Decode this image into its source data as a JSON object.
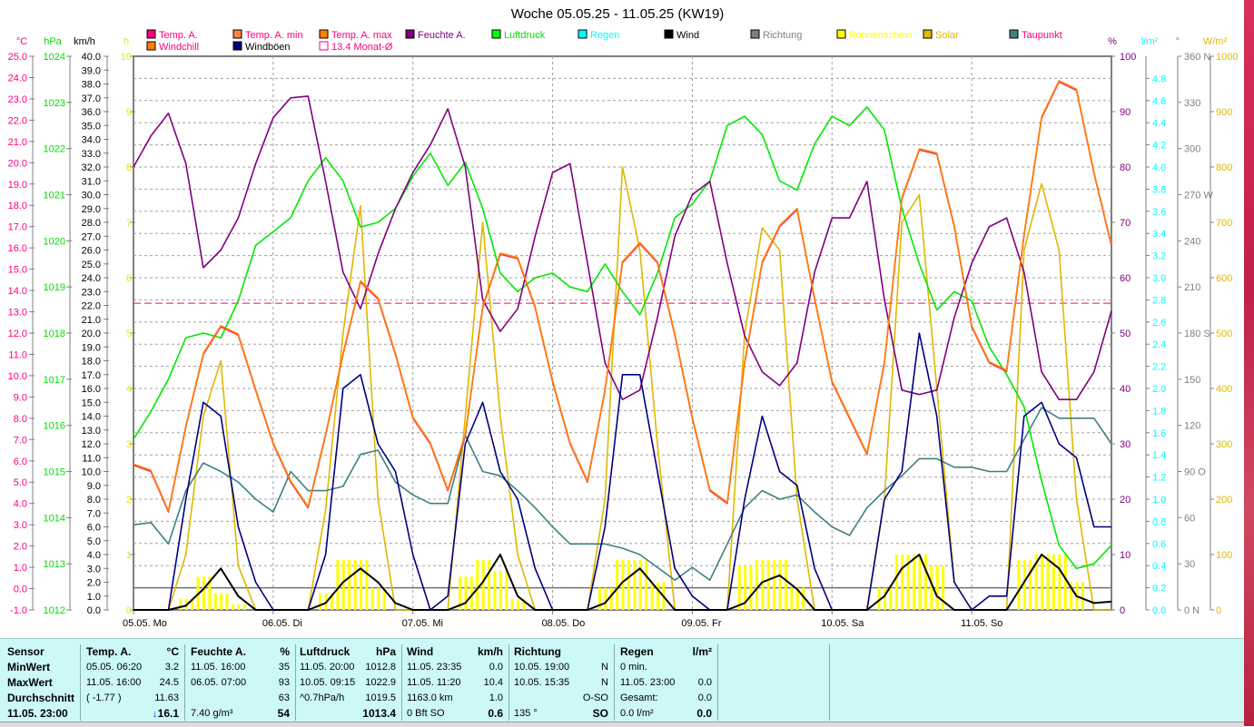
{
  "chart_data": {
    "type": "line",
    "title": "Woche 05.05.25 - 11.05.25 (KW19)",
    "x_unit": "hours since 05.05. 00:00",
    "x_step_hours": 3,
    "xlim": [
      0,
      168
    ],
    "day_labels": [
      "05.05.  Mo",
      "06.05.  Di",
      "07.05.  Mi",
      "08.05.  Do",
      "09.05.  Fr",
      "10.05.  Sa",
      "11.05.  So"
    ],
    "legend": [
      {
        "label": "Temp. A.",
        "color": "#ff0080",
        "row": 1
      },
      {
        "label": "Temp. A. min",
        "color": "#ff8040",
        "row": 1
      },
      {
        "label": "Temp. A. max",
        "color": "#ff8000",
        "row": 1
      },
      {
        "label": "Feuchte A.",
        "color": "#800080",
        "row": 1
      },
      {
        "label": "Luftdruck",
        "color": "#00ff00",
        "row": 1
      },
      {
        "label": "Regen",
        "color": "#00ffff",
        "row": 1
      },
      {
        "label": "Wind",
        "color": "#000000",
        "row": 1
      },
      {
        "label": "Richtung",
        "color": "#808080",
        "row": 1
      },
      {
        "label": "Sonnenschein",
        "color": "#ffff00",
        "row": 1
      },
      {
        "label": "Solar",
        "color": "#e0b800",
        "row": 1
      },
      {
        "label": "Taupunkt",
        "color": "#408080",
        "row": 1
      },
      {
        "label": "Windchill",
        "color": "#ff8000",
        "row": 2
      },
      {
        "label": "Windböen",
        "color": "#000080",
        "row": 2
      },
      {
        "label": "13.4 Monat-Ø",
        "color": "#ff0080",
        "row": 2,
        "outline": true
      }
    ],
    "legend_text_colors": {
      "Temp. A.": "#ff0080",
      "Temp. A. min": "#ff0080",
      "Temp. A. max": "#ff0080",
      "Feuchte A.": "#800080",
      "Luftdruck": "#00e000",
      "Regen": "#00ffff",
      "Wind": "#000000",
      "Richtung": "#808080",
      "Sonnenschein": "#ffff00",
      "Solar": "#e0b800",
      "Taupunkt": "#ff0080",
      "Windchill": "#ff0080",
      "Windböen": "#000000",
      "13.4 Monat-Ø": "#ff0080"
    },
    "axes": {
      "temp": {
        "unit": "°C",
        "min": -1,
        "max": 25,
        "step": 1,
        "decimals": 1,
        "color": "#ff0080"
      },
      "pressure": {
        "unit": "hPa",
        "min": 1012,
        "max": 1024,
        "step": 1,
        "decimals": 0,
        "color": "#00e000"
      },
      "wind": {
        "unit": "km/h",
        "min": 0,
        "max": 40,
        "step": 1,
        "decimals": 1,
        "color": "#000000"
      },
      "sun": {
        "unit": "h",
        "min": 0,
        "max": 10,
        "step": 1,
        "decimals": 0,
        "color": "#e8e800"
      },
      "humidity": {
        "unit": "%",
        "min": 0,
        "max": 100,
        "step": 10,
        "decimals": 0,
        "color": "#800080"
      },
      "rain": {
        "unit": "l/m²",
        "min": 0,
        "max": 5,
        "step": 0.2,
        "label_max": 4.8,
        "decimals": 1,
        "color": "#00ffff"
      },
      "direction": {
        "unit": "°",
        "min": 0,
        "max": 360,
        "step": 30,
        "decimals": 0,
        "color": "#808080",
        "suffix": {
          "360": " N",
          "270": " W",
          "180": " S",
          "90": " O",
          "0": " N"
        }
      },
      "solar": {
        "unit": "W/m²",
        "min": 0,
        "max": 1000,
        "step": 100,
        "decimals": 0,
        "color": "#e0b800"
      }
    },
    "monthly_avg_temp": 13.4,
    "reference_line_kmh": 1.6,
    "series": [
      {
        "name": "Temp. A.",
        "axis": "temp",
        "color": "#ff2060",
        "values": [
          5.8,
          5.5,
          3.6,
          7.6,
          11,
          12.3,
          11.9,
          9.3,
          6.8,
          5,
          3.8,
          7.2,
          11,
          14.4,
          13.6,
          11,
          8,
          6.8,
          4.6,
          7.2,
          13.2,
          15.7,
          15.5,
          13.2,
          9.7,
          6.8,
          5,
          9.3,
          15.3,
          16.2,
          15.3,
          11.9,
          8,
          4.6,
          4,
          10.6,
          15.3,
          17,
          17.8,
          13.6,
          9.7,
          8,
          6.3,
          10.6,
          18.3,
          20.6,
          20.4,
          17,
          12.3,
          10.6,
          10.2,
          16.6,
          22.1,
          23.8,
          23.4,
          19.5,
          16.1
        ]
      },
      {
        "name": "Windchill",
        "axis": "temp",
        "color": "#ff8000",
        "values": [
          5.8,
          5.5,
          3.6,
          7.6,
          11,
          12.3,
          11.9,
          9.3,
          6.8,
          5,
          3.8,
          7.2,
          11,
          14.4,
          13.6,
          11,
          8,
          6.8,
          4.6,
          7.2,
          13.2,
          15.7,
          15.5,
          13.2,
          9.7,
          6.8,
          5,
          9.3,
          15.3,
          16.2,
          15.3,
          11.9,
          8,
          4.6,
          4,
          10.6,
          15.3,
          17,
          17.8,
          13.6,
          9.7,
          8,
          6.3,
          10.6,
          18.3,
          20.6,
          20.4,
          17,
          12.3,
          10.6,
          10.2,
          16.6,
          22.1,
          23.8,
          23.4,
          19.5,
          16.1
        ]
      },
      {
        "name": "Feuchte A.",
        "axis": "humidity",
        "color": "#800080",
        "values": [
          80,
          85.6,
          89.7,
          80.6,
          61.8,
          65,
          70.8,
          80.6,
          88.9,
          92.5,
          92.8,
          77.4,
          61,
          54.4,
          64.3,
          72.5,
          79,
          84,
          90.5,
          80,
          56,
          50.3,
          54.4,
          67.5,
          79,
          80.6,
          62.6,
          44.6,
          38,
          39.7,
          52.8,
          67.5,
          75,
          77.4,
          62.6,
          49.5,
          43,
          40.5,
          44.6,
          61,
          70.8,
          70.8,
          77.4,
          56,
          39.7,
          38.9,
          39.7,
          52.8,
          62.6,
          69.2,
          70.8,
          61,
          43,
          38,
          38,
          43,
          54
        ]
      },
      {
        "name": "Luftdruck",
        "axis": "pressure",
        "color": "#00e800",
        "values": [
          1015.7,
          1016.3,
          1017,
          1017.9,
          1018,
          1017.9,
          1018.7,
          1019.9,
          1020.2,
          1020.5,
          1021.3,
          1021.8,
          1021.3,
          1020.3,
          1020.4,
          1020.7,
          1021.4,
          1021.9,
          1021.2,
          1021.7,
          1020.7,
          1019.3,
          1018.9,
          1019.2,
          1019.3,
          1019,
          1018.9,
          1019.5,
          1018.9,
          1018.4,
          1019.3,
          1020.5,
          1020.8,
          1021.3,
          1022.5,
          1022.7,
          1022.3,
          1021.3,
          1021.1,
          1022.1,
          1022.7,
          1022.5,
          1022.9,
          1022.4,
          1020.7,
          1019.5,
          1018.5,
          1018.9,
          1018.7,
          1017.7,
          1017.1,
          1016.4,
          1014.8,
          1013.4,
          1012.9,
          1013,
          1013.4
        ]
      },
      {
        "name": "Taupunkt",
        "axis": "temp",
        "color": "#408080",
        "values": [
          3,
          3.1,
          2.1,
          4.6,
          5.9,
          5.5,
          5,
          4.2,
          3.6,
          5.5,
          4.6,
          4.6,
          4.8,
          6.3,
          6.5,
          5,
          4.4,
          4,
          4,
          7.2,
          5.5,
          5.3,
          4.6,
          3.8,
          2.9,
          2.1,
          2.1,
          2.1,
          1.9,
          1.6,
          1,
          0.4,
          1,
          0.4,
          2.1,
          3.8,
          4.6,
          4.2,
          4.4,
          3.6,
          2.9,
          2.5,
          3.8,
          4.6,
          5.3,
          6.1,
          6.1,
          5.7,
          5.7,
          5.5,
          5.5,
          7,
          8.5,
          8,
          8,
          8,
          6.8
        ]
      },
      {
        "name": "Windböen",
        "axis": "wind",
        "color": "#000080",
        "values": [
          0,
          0,
          0,
          8,
          15,
          14,
          6,
          2,
          0,
          0,
          0,
          4,
          16,
          17,
          12,
          10,
          4,
          0,
          1,
          12,
          15,
          10,
          8,
          3,
          0,
          0,
          0,
          6,
          17,
          17,
          10,
          3,
          1,
          0,
          0,
          8,
          14,
          10,
          9,
          3,
          0,
          0,
          0,
          8,
          10,
          20,
          14,
          2,
          0,
          1,
          1,
          14,
          15,
          12,
          11,
          6,
          6
        ]
      },
      {
        "name": "Wind",
        "axis": "wind",
        "color": "#000000",
        "values": [
          0,
          0,
          0,
          0.3,
          1.5,
          3,
          1,
          0,
          0,
          0,
          0,
          0.5,
          2,
          3,
          2,
          0.5,
          0,
          0,
          0,
          0.5,
          2,
          4,
          1,
          0,
          0,
          0,
          0,
          0.5,
          2,
          3,
          1.5,
          0,
          0,
          0,
          0,
          0.5,
          2,
          2.5,
          1.5,
          0,
          0,
          0,
          0,
          1,
          3,
          4,
          1,
          0,
          0,
          0,
          0,
          2,
          4,
          3,
          1,
          0.5,
          0.6
        ]
      },
      {
        "name": "Solar",
        "axis": "solar",
        "color": "#e0b800",
        "values": [
          0,
          0,
          0,
          100,
          350,
          450,
          80,
          0,
          0,
          0,
          0,
          180,
          500,
          730,
          200,
          0,
          0,
          0,
          0,
          350,
          700,
          350,
          100,
          0,
          0,
          0,
          0,
          200,
          800,
          650,
          300,
          0,
          0,
          0,
          0,
          500,
          690,
          650,
          200,
          0,
          0,
          0,
          0,
          200,
          700,
          750,
          400,
          50,
          0,
          0,
          0,
          650,
          770,
          650,
          200,
          0,
          0
        ]
      },
      {
        "name": "Sonnenschein",
        "axis": "sun",
        "color": "#ffff00",
        "bars": true,
        "values": [
          0,
          0,
          0,
          0.2,
          0.6,
          0.3,
          0.1,
          0,
          0,
          0,
          0,
          0.3,
          0.9,
          0.9,
          0.4,
          0,
          0,
          0,
          0,
          0.6,
          0.9,
          0.7,
          0.2,
          0,
          0,
          0,
          0,
          0.4,
          0.9,
          0.9,
          0.5,
          0,
          0,
          0,
          0,
          0.8,
          0.9,
          0.9,
          0.4,
          0,
          0,
          0,
          0,
          0.4,
          1,
          1,
          0.8,
          0,
          0,
          0,
          0,
          0.9,
          1,
          1,
          0.5,
          0,
          0
        ]
      }
    ]
  },
  "table": {
    "columns": [
      {
        "header": "Sensor",
        "unit": "",
        "rows": [
          [
            "MinWert",
            ""
          ],
          [
            "MaxWert",
            ""
          ],
          [
            "Durchschnitt",
            ""
          ],
          [
            "11.05. 23:00",
            ""
          ]
        ],
        "bold_labels": true
      },
      {
        "header": "Temp. A.",
        "unit": "°C",
        "rows": [
          [
            "05.05.  06:20",
            "3.2"
          ],
          [
            "11.05.  16:00",
            "24.5"
          ],
          [
            "( -1.77 )",
            "11.63"
          ],
          [
            "",
            "16.1"
          ]
        ],
        "trend_icon": "↓"
      },
      {
        "header": "Feuchte A.",
        "unit": "%",
        "rows": [
          [
            "11.05.  16:00",
            "35"
          ],
          [
            "06.05.  07:00",
            "93"
          ],
          [
            "",
            "63"
          ],
          [
            "7.40 g/m³",
            "54"
          ]
        ]
      },
      {
        "header": "Luftdruck",
        "unit": "hPa",
        "rows": [
          [
            "11.05.  20:00",
            "1012.8"
          ],
          [
            "10.05.  09:15",
            "1022.9"
          ],
          [
            "^0.7hPa/h",
            "1019.5"
          ],
          [
            "",
            "1013.4"
          ]
        ]
      },
      {
        "header": "Wind",
        "unit": "km/h",
        "rows": [
          [
            "11.05.  23:35",
            "0.0"
          ],
          [
            "11.05.  11:20",
            "10.4"
          ],
          [
            "1163.0 km",
            "1.0"
          ],
          [
            "0 Bft SO",
            "0.6"
          ]
        ]
      },
      {
        "header": "Richtung",
        "unit": "",
        "rows": [
          [
            "10.05.  19:00",
            "N"
          ],
          [
            "10.05.  15:35",
            "N"
          ],
          [
            "",
            "O-SO"
          ],
          [
            "135 °",
            "SO"
          ]
        ]
      },
      {
        "header": "Regen",
        "unit": "l/m²",
        "rows": [
          [
            "0 min.",
            ""
          ],
          [
            "11.05.  23:00",
            "0.0"
          ],
          [
            "Gesamt:",
            "0.0"
          ],
          [
            "0.0 l/m²",
            "0.0"
          ]
        ]
      }
    ]
  }
}
